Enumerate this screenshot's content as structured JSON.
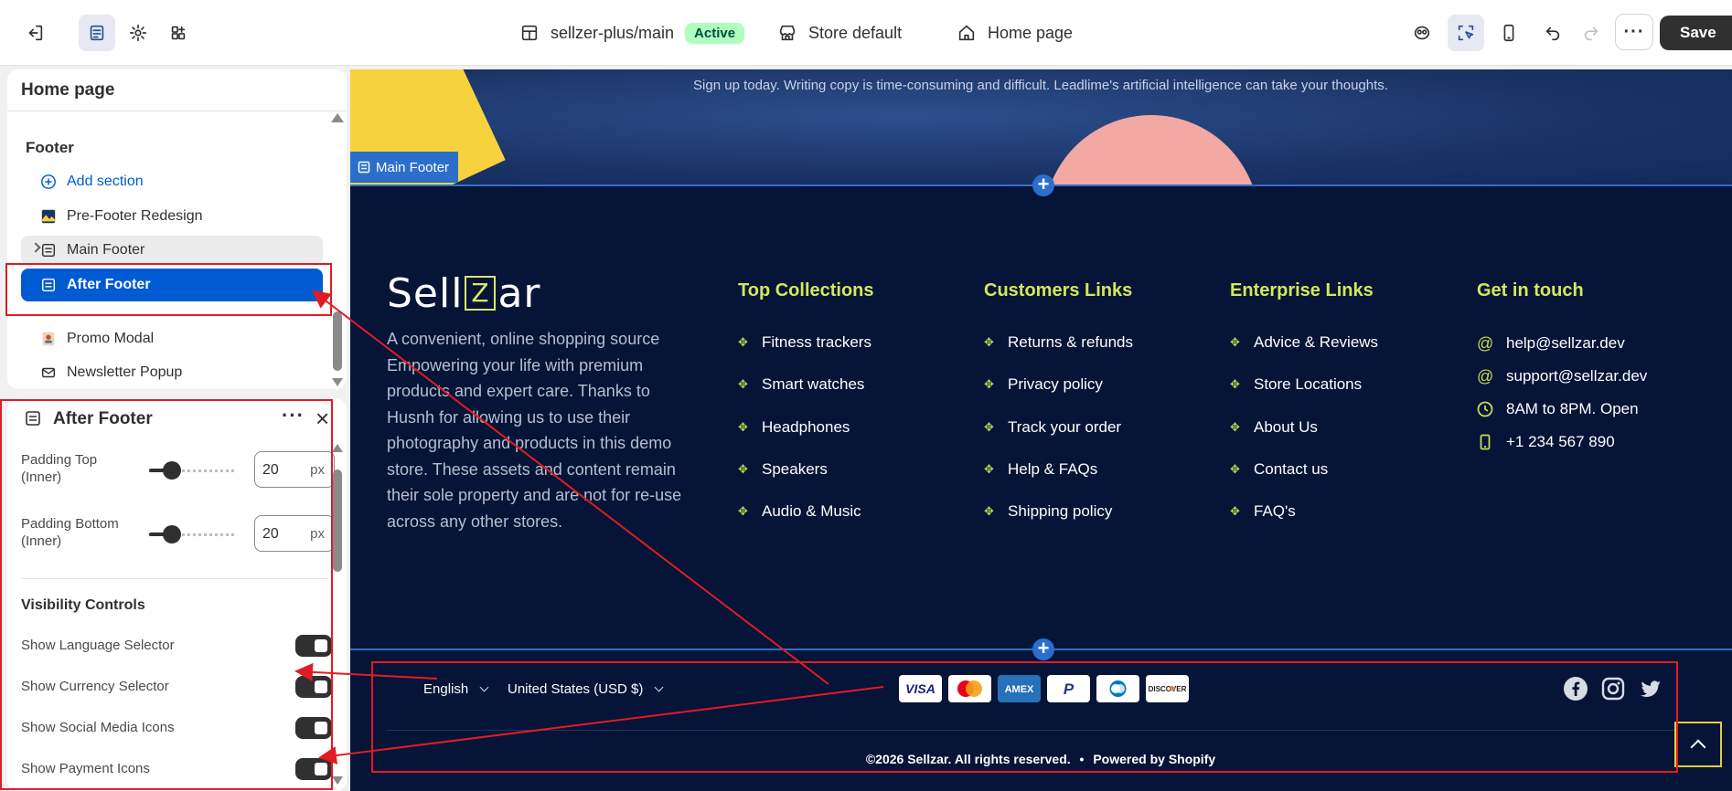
{
  "topbar": {
    "theme": "sellzer-plus/main",
    "status": "Active",
    "store": "Store default",
    "page": "Home page",
    "save_label": "Save"
  },
  "left_panel": {
    "title": "Home page",
    "group": "Footer",
    "add_section": "Add section",
    "items": [
      {
        "label": "Pre-Footer Redesign",
        "icon": "image-icon"
      },
      {
        "label": "Main Footer",
        "icon": "section-icon"
      },
      {
        "label": "After Footer",
        "icon": "section-icon"
      },
      {
        "label": "Promo Modal",
        "icon": "image-icon"
      },
      {
        "label": "Newsletter Popup",
        "icon": "mail-icon"
      }
    ]
  },
  "settings": {
    "title": "After Footer",
    "padding_top": {
      "label": "Padding Top (Inner)",
      "value": "20",
      "unit": "px"
    },
    "padding_bottom": {
      "label": "Padding Bottom (Inner)",
      "value": "20",
      "unit": "px"
    },
    "visibility_title": "Visibility Controls",
    "toggles": [
      {
        "label": "Show Language Selector",
        "on": true
      },
      {
        "label": "Show Currency Selector",
        "on": true
      },
      {
        "label": "Show Social Media Icons",
        "on": true
      },
      {
        "label": "Show Payment Icons",
        "on": true
      }
    ]
  },
  "preview": {
    "hero_text": "Sign up today. Writing copy is time-consuming and difficult. Leadlime's artificial intelligence can take your thoughts.",
    "main_footer_label": "Main Footer",
    "logo": {
      "before": "Sell",
      "box": "Z",
      "after": "ar"
    },
    "about": "A convenient, online shopping source Empowering your life with premium products and expert care. Thanks to Husnh for allowing us to use their photography and products in this demo store. These assets and content remain their sole property and are not for re-use across any other stores.",
    "columns": [
      {
        "title": "Top Collections",
        "links": [
          "Fitness trackers",
          "Smart watches",
          "Headphones",
          "Speakers",
          "Audio & Music"
        ]
      },
      {
        "title": "Customers Links",
        "links": [
          "Returns & refunds",
          "Privacy policy",
          "Track your order",
          "Help & FAQs",
          "Shipping policy"
        ]
      },
      {
        "title": "Enterprise Links",
        "links": [
          "Advice & Reviews",
          "Store Locations",
          "About Us",
          "Contact us",
          "FAQ's"
        ]
      }
    ],
    "contact": {
      "title": "Get in touch",
      "items": [
        "help@sellzar.dev",
        "support@sellzar.dev",
        "8AM to 8PM. Open",
        "+1 234 567 890"
      ]
    },
    "language": "English",
    "currency": "United States (USD $)",
    "payments": [
      "VISA",
      "Mastercard",
      "AMEX",
      "PayPal",
      "Diners",
      "DISCOVER"
    ],
    "socials": [
      "facebook-icon",
      "instagram-icon",
      "twitter-icon"
    ],
    "copyright": "©2026 Sellzar. All rights reserved.",
    "powered": "Powered by Shopify",
    "separator": "•"
  }
}
